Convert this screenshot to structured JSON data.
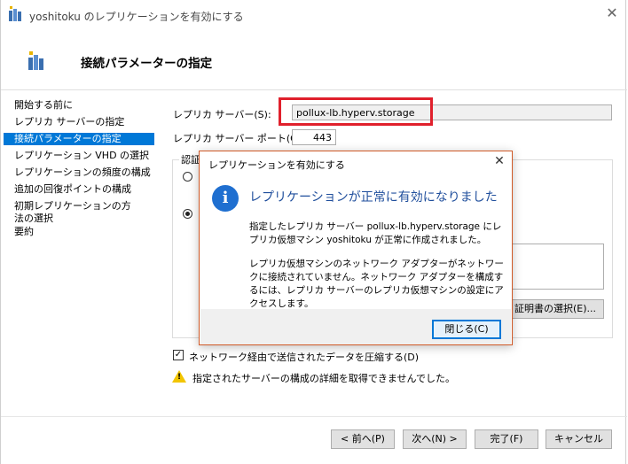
{
  "window": {
    "title": "yoshitoku のレプリケーションを有効にする",
    "icon": "replica-server-icon",
    "close_glyph": "✕"
  },
  "header": {
    "title": "接続パラメーターの指定",
    "icon": "replica-server-icon"
  },
  "nav": {
    "items": [
      {
        "label": "開始する前に",
        "selected": false
      },
      {
        "label": "レプリカ サーバーの指定",
        "selected": false
      },
      {
        "label": "接続パラメーターの指定",
        "selected": true
      },
      {
        "label": "レプリケーション VHD の選択",
        "selected": false
      },
      {
        "label": "レプリケーションの頻度の構成",
        "selected": false
      },
      {
        "label": "追加の回復ポイントの構成",
        "selected": false
      },
      {
        "label": "初期レプリケーションの方法の選択",
        "selected": false
      },
      {
        "label": "要約",
        "selected": false
      }
    ]
  },
  "form": {
    "replica_server_label": "レプリカ サーバー(S):",
    "replica_server_value": "pollux-lb.hyperv.storage",
    "replica_port_label": "レプリカ サーバー ポート(O):",
    "replica_port_value": "443",
    "auth_group_label": "認証",
    "select_cert_button": "証明書の選択(E)...",
    "compress_label": "ネットワーク経由で送信されたデータを圧縮する(D)",
    "compress_checked": true,
    "warning_text": "指定されたサーバーの構成の詳細を取得できませんでした。"
  },
  "footer": {
    "back": "< 前へ(P)",
    "next": "次へ(N) >",
    "finish": "完了(F)",
    "cancel": "キャンセル"
  },
  "dialog": {
    "title": "レプリケーションを有効にする",
    "close_glyph": "✕",
    "icon": "info-icon",
    "heading": "レプリケーションが正常に有効になりました",
    "para1": "指定したレプリカ サーバー pollux-lb.hyperv.storage にレプリカ仮想マシン yoshitoku が正常に作成されました。",
    "para2": "レプリカ仮想マシンのネットワーク アダプターがネットワークに接続されていません。ネットワーク アダプターを構成するには、レプリカ サーバーのレプリカ仮想マシンの設定にアクセスします。",
    "close_button": "閉じる(C)"
  },
  "colors": {
    "accent": "#0078d7",
    "highlight_box": "#e0202c",
    "dialog_border": "#d05a28",
    "dialog_heading": "#1f4e9c",
    "warning": "#f2c500"
  }
}
